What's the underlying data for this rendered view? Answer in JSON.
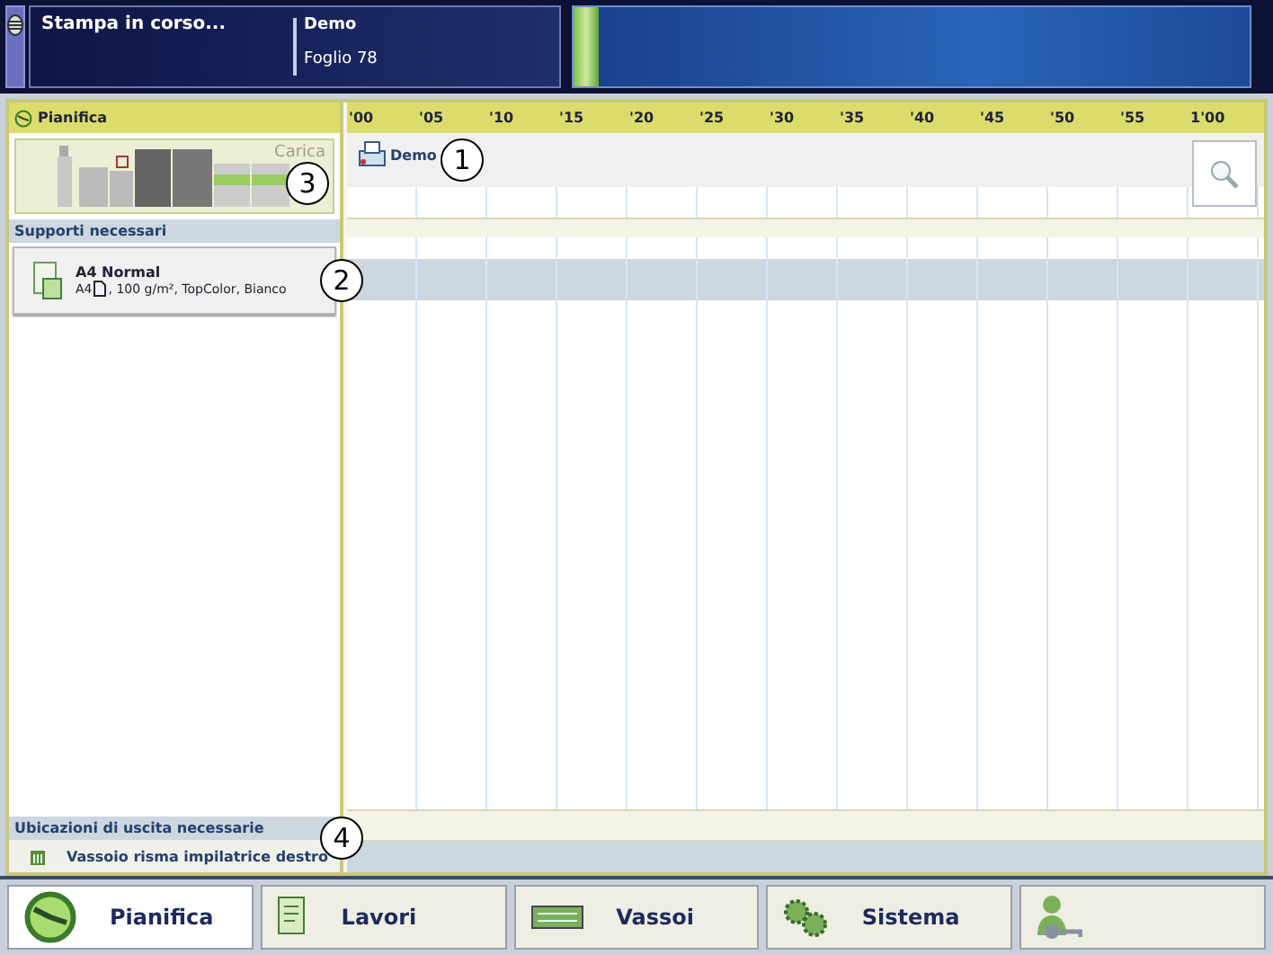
{
  "top_bar": {
    "status": "Stampa in corso...",
    "job": "Demo",
    "sheet": "Foglio 78"
  },
  "schedule": {
    "title": "Pianifica",
    "ticks": [
      "'00",
      "'05",
      "'10",
      "'15",
      "'20",
      "'25",
      "'30",
      "'35",
      "'40",
      "'45",
      "'50",
      "'55",
      "1'00"
    ],
    "job": "Demo"
  },
  "printer": {
    "load_label": "Carica"
  },
  "media": {
    "title": "Supporti necessari",
    "items": [
      {
        "name": "A4 Normal",
        "size": "A4",
        "details": ", 100 g/m², TopColor, Bianco"
      }
    ]
  },
  "outputs": {
    "title": "Ubicazioni di uscita necessarie",
    "items": [
      {
        "name": "Vassoio risma impilatrice destro"
      }
    ]
  },
  "nav": [
    {
      "kind": "schedule",
      "label": "Pianifica",
      "selected": true
    },
    {
      "kind": "jobs",
      "label": "Lavori",
      "selected": false
    },
    {
      "kind": "trays",
      "label": "Vassoi",
      "selected": false
    },
    {
      "kind": "system",
      "label": "Sistema",
      "selected": false
    },
    {
      "kind": "user",
      "selected": false
    }
  ],
  "callouts": [
    "1",
    "2",
    "3",
    "4"
  ]
}
